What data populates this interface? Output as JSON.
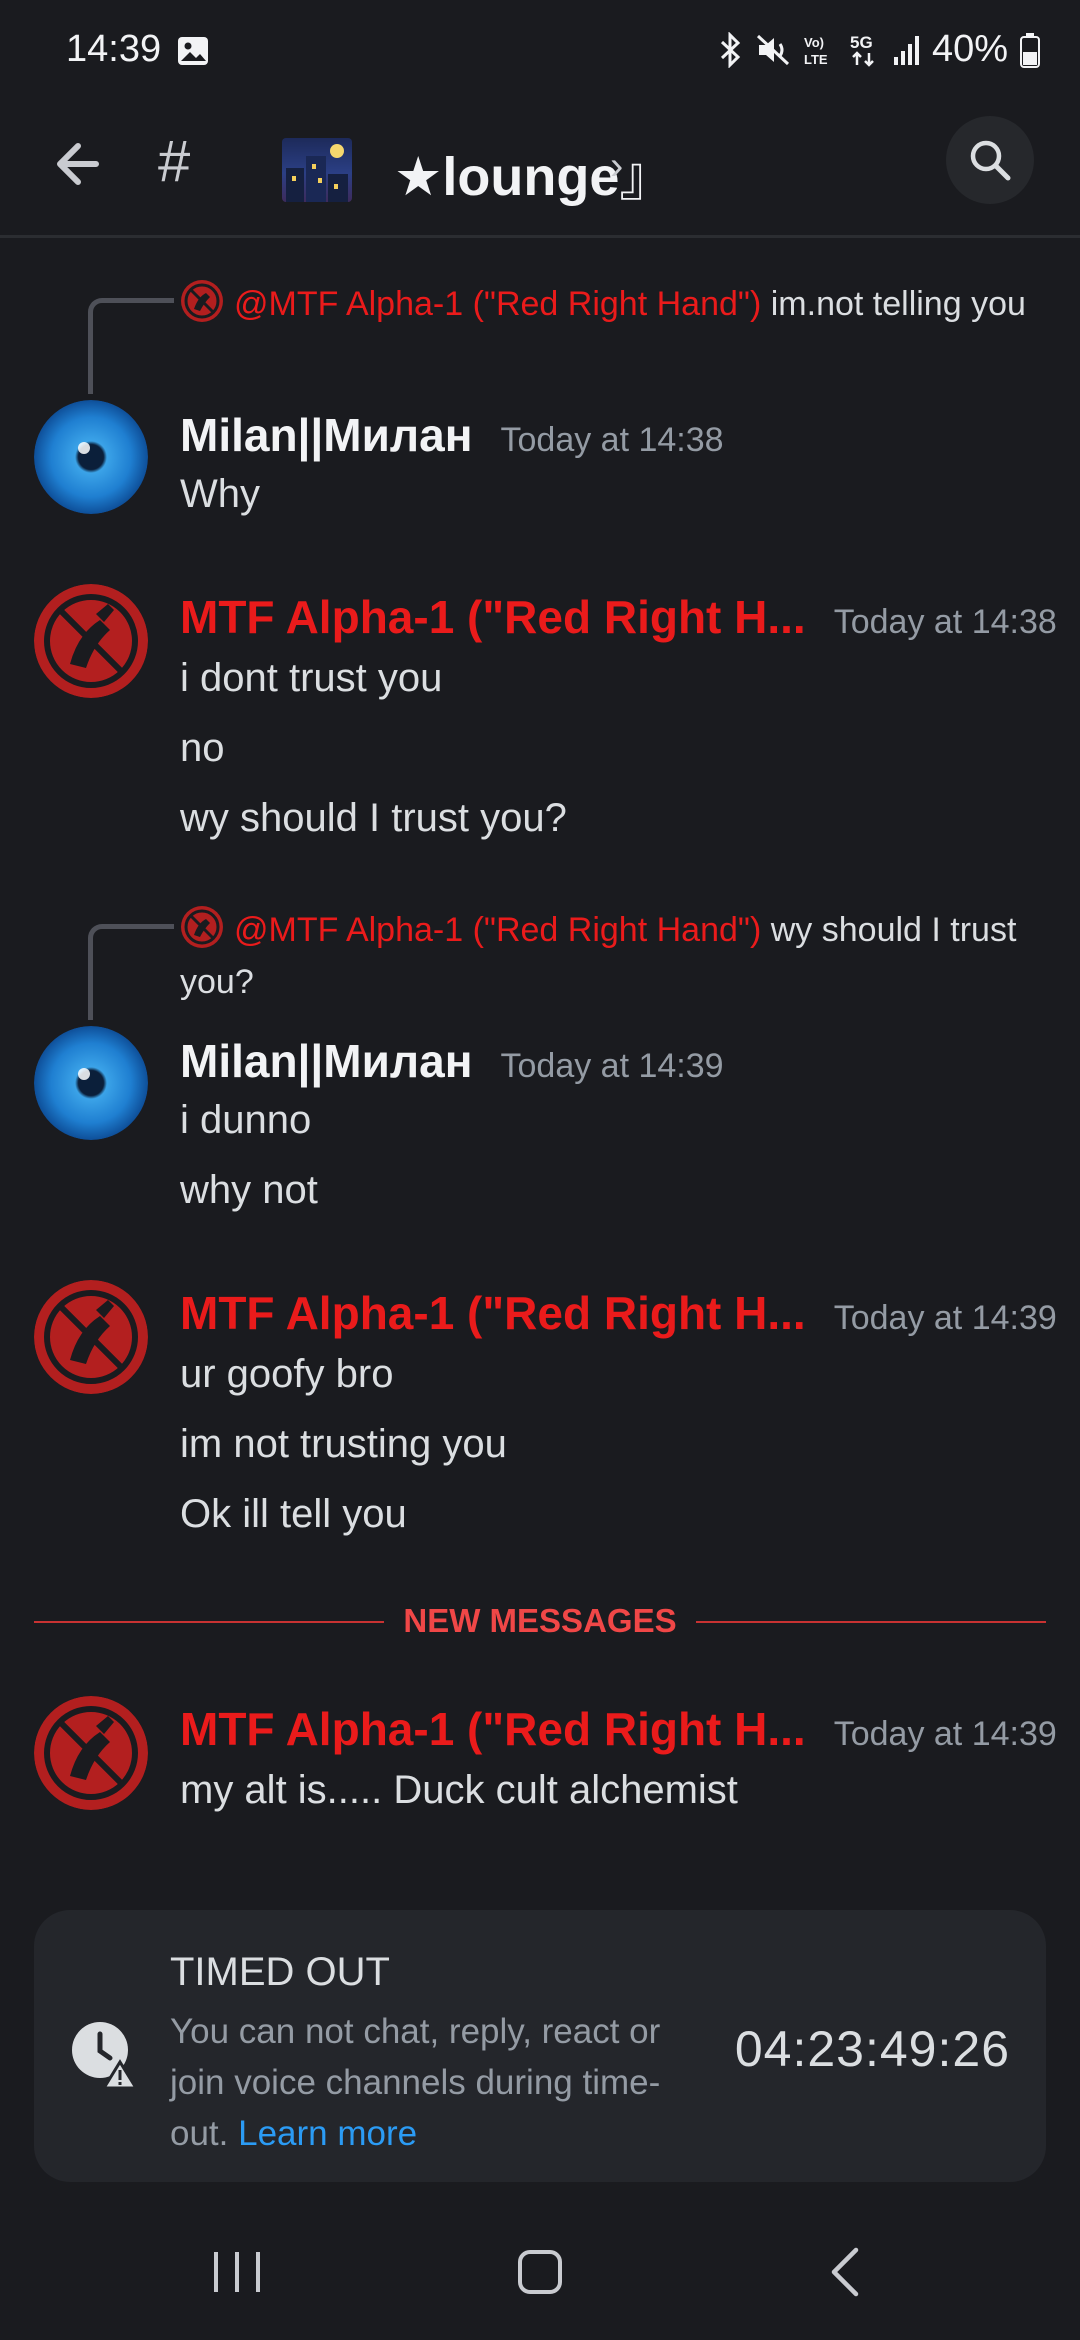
{
  "status_bar": {
    "time": "14:39",
    "battery": "40%",
    "icons": [
      "image-icon",
      "bluetooth-icon",
      "mute-icon",
      "volte-icon",
      "5g-icon",
      "signal-icon",
      "battery-icon"
    ]
  },
  "header": {
    "channel_prefix": "#",
    "channel_open": "『",
    "channel_name": "★lounge",
    "channel_close": "』",
    "channel_chevron": "›"
  },
  "messages": [
    {
      "reply_to": "@MTF Alpha-1 (\"Red Right Hand\")",
      "reply_text": "im.not telling you",
      "author": "Milan||Милан",
      "timestamp": "Today at 14:38",
      "lines": [
        "Why"
      ]
    },
    {
      "author": "MTF Alpha-1 (\"Red Right H...",
      "timestamp": "Today at 14:38",
      "lines": [
        "i dont trust you",
        "no",
        "wy should I trust you?"
      ]
    },
    {
      "reply_to": "@MTF Alpha-1 (\"Red Right Hand\")",
      "reply_text": "wy should I trust you?",
      "author": "Milan||Милан",
      "timestamp": "Today at 14:39",
      "lines": [
        "i dunno",
        "why not"
      ]
    },
    {
      "author": "MTF Alpha-1 (\"Red Right H...",
      "timestamp": "Today at 14:39",
      "lines": [
        "ur goofy bro",
        "im not trusting you",
        "Ok ill tell you"
      ]
    },
    {
      "author": "MTF Alpha-1 (\"Red Right H...",
      "timestamp": "Today at 14:39",
      "lines": [
        "my alt is..... Duck cult alchemist"
      ]
    }
  ],
  "new_messages_label": "NEW MESSAGES",
  "timeout": {
    "title": "TIMED OUT",
    "body": "You can not chat, reply, react or join voice channels during time-out.",
    "learn_more": "Learn more",
    "timer": "04:23:49:26"
  },
  "colors": {
    "background": "#1a1b1f",
    "red_role": "#ea1b1b",
    "divider_red": "#f04747",
    "link_blue": "#2b9bf4",
    "muted": "#949ba4"
  }
}
